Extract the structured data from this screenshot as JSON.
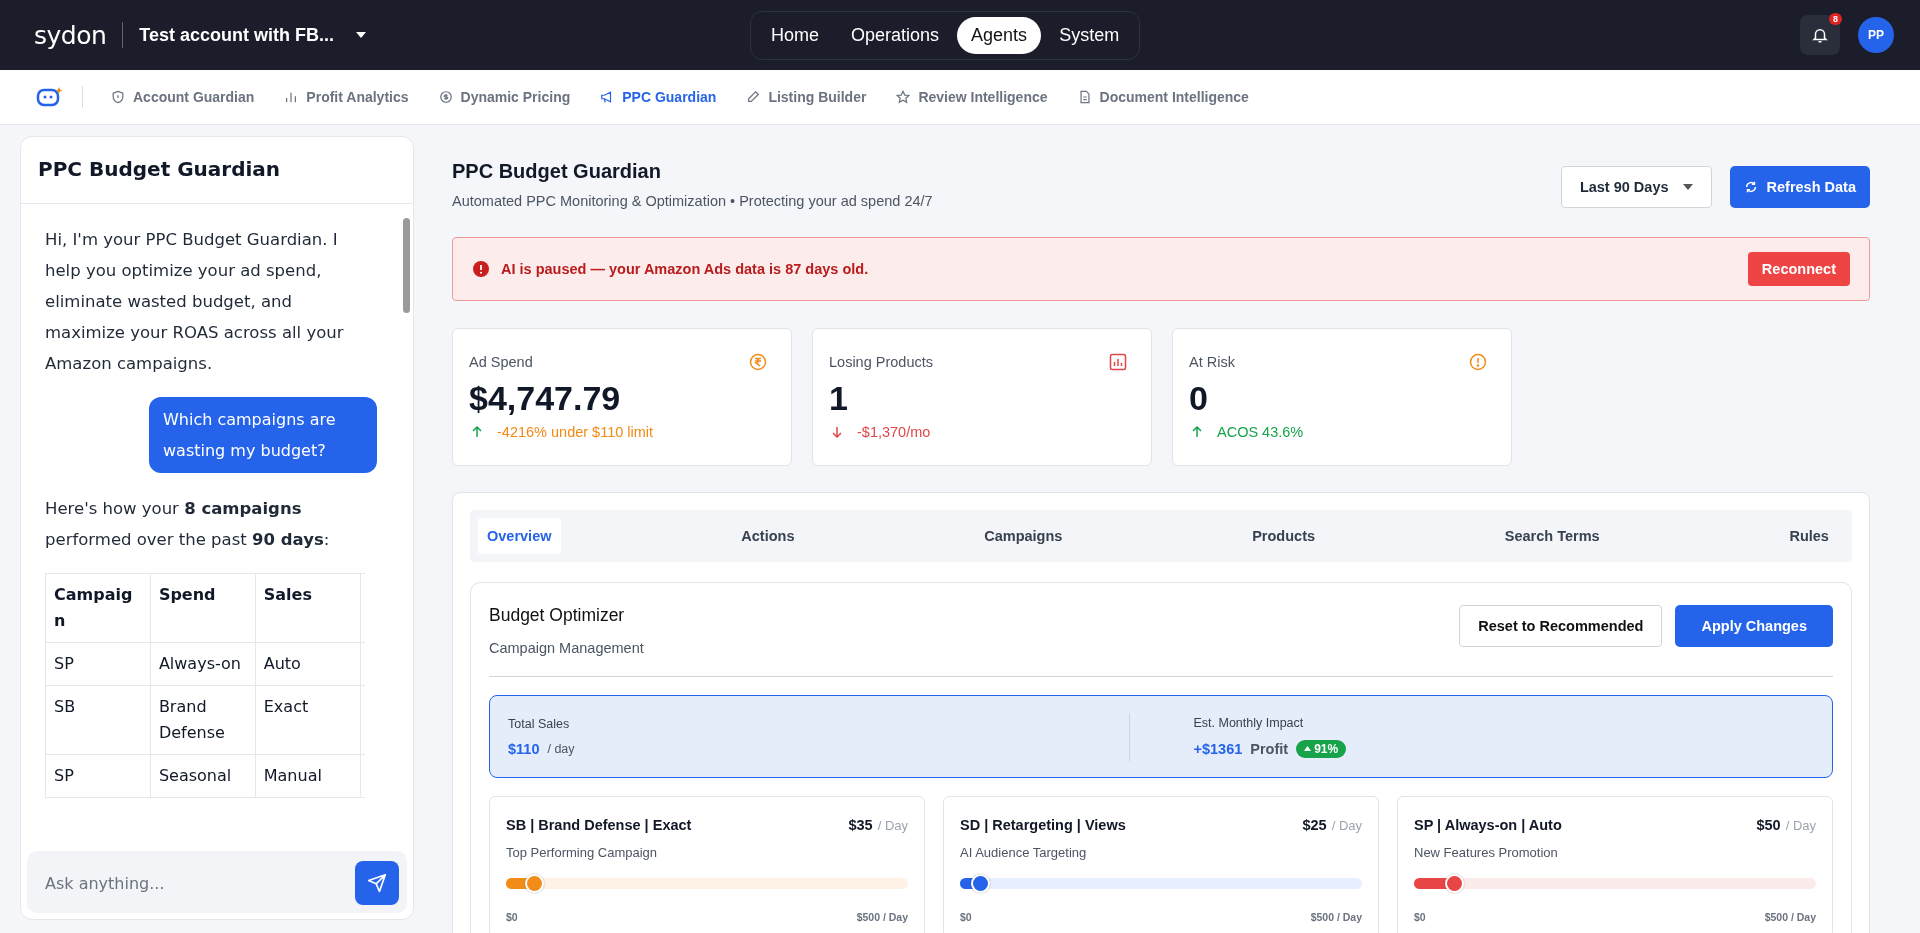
{
  "topbar": {
    "logo": "sydon",
    "account": "Test account with FB...",
    "nav": [
      {
        "label": "Home",
        "selected": false
      },
      {
        "label": "Operations",
        "selected": false
      },
      {
        "label": "Agents",
        "selected": true
      },
      {
        "label": "System",
        "selected": false
      }
    ],
    "notifications": "8",
    "avatar": "PP"
  },
  "subnav": [
    {
      "label": "Account Guardian",
      "selected": false
    },
    {
      "label": "Profit Analytics",
      "selected": false
    },
    {
      "label": "Dynamic Pricing",
      "selected": false
    },
    {
      "label": "PPC Guardian",
      "selected": true
    },
    {
      "label": "Listing Builder",
      "selected": false
    },
    {
      "label": "Review Intelligence",
      "selected": false
    },
    {
      "label": "Document Intelligence",
      "selected": false
    }
  ],
  "chat": {
    "title": "PPC Budget Guardian",
    "messages": [
      {
        "kind": "assistant",
        "text": "Hi, I'm your PPC Budget Guardian. I help you optimize your ad spend, eliminate wasted budget, and maximize your ROAS across all your Amazon campaigns."
      },
      {
        "kind": "user",
        "text": "Which campaigns are wasting my budget?"
      },
      {
        "kind": "assistant",
        "text": "Here's how your **8 campaigns** performed over the past **90 days**:"
      },
      {
        "kind": "table",
        "columns": [
          "Campaign",
          "Spend",
          "Sales"
        ],
        "rows": [
          [
            "SP",
            "Always-on",
            "Auto"
          ],
          [
            "SB",
            "Brand Defense",
            "Exact"
          ],
          [
            "SP",
            "Seasonal",
            "Manual"
          ]
        ]
      }
    ],
    "input": {
      "placeholder": "Ask anything..."
    }
  },
  "header": {
    "title": "PPC Budget Guardian",
    "subtitle": "Automated PPC Monitoring & Optimization • Protecting your ad spend 24/7",
    "range": "Last 90 Days",
    "refresh": "Refresh Data"
  },
  "alert": {
    "text": "AI is paused — your Amazon Ads data is 87 days old.",
    "action": "Reconnect"
  },
  "stats": [
    {
      "kind": "warning",
      "label": "Ad Spend",
      "value": "$4,747.79",
      "note": "-4216% under $110 limit"
    },
    {
      "kind": "loss",
      "label": "Losing Products",
      "value": "1",
      "note": "-$1,370/mo"
    },
    {
      "kind": "success",
      "label": "At Risk",
      "value": "0",
      "note": "ACOS 43.6%"
    }
  ],
  "tabs": [
    {
      "label": "Overview",
      "selected": true
    },
    {
      "label": "Actions",
      "selected": false
    },
    {
      "label": "Campaigns",
      "selected": false
    },
    {
      "label": "Products",
      "selected": false
    },
    {
      "label": "Search Terms",
      "selected": false
    },
    {
      "label": "Rules",
      "selected": false
    }
  ],
  "optimizer": {
    "title": "Budget Optimizer",
    "subtitle": "Campaign Management",
    "reset": "Reset to Recommended",
    "apply": "Apply Changes",
    "summary": {
      "sales_label": "Total Sales",
      "sales_value": "$110",
      "sales_unit": "/ day",
      "impact_label": "Est. Monthly Impact",
      "impact_value": "+$1361",
      "impact_unit": "Profit",
      "badge": "91%"
    },
    "campaigns": [
      {
        "name": "SB | Brand Defense | Exact",
        "amount": "$35",
        "unit": "/ Day",
        "desc": "Top Performing Campaign",
        "level": 0.07,
        "color": "#f28c18",
        "min": "$0",
        "max": "$500 / Day"
      },
      {
        "name": "SD | Retargeting | Views",
        "amount": "$25",
        "unit": "/ Day",
        "desc": "AI Audience Targeting",
        "level": 0.05,
        "color": "#2563eb",
        "min": "$0",
        "max": "$500 / Day"
      },
      {
        "name": "SP | Always-on | Auto",
        "amount": "$50",
        "unit": "/ Day",
        "desc": "New Features Promotion",
        "level": 0.1,
        "color": "#e84545",
        "min": "$0",
        "max": "$500 / Day"
      }
    ]
  }
}
